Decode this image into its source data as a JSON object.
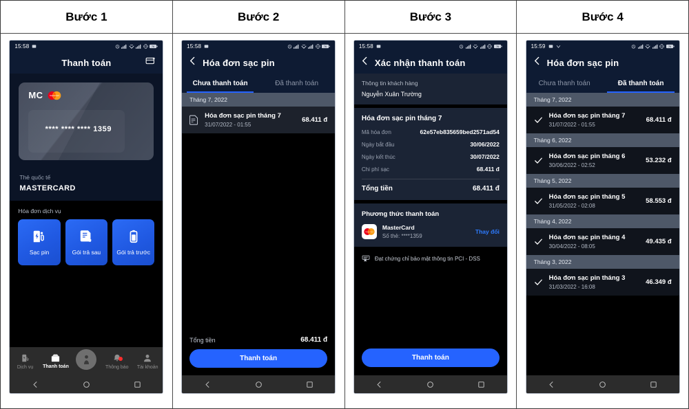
{
  "table": {
    "headers": [
      "Bước 1",
      "Bước 2",
      "Bước 3",
      "Bước 4"
    ]
  },
  "status_bar": {
    "time_1": "15:58",
    "time_2": "15:58",
    "time_3": "15:58",
    "time_4": "15:59",
    "icons": [
      "alarm-icon",
      "signal-icon",
      "wifi-icon",
      "signal-icon",
      "vibrate-icon",
      "battery-icon"
    ]
  },
  "step1": {
    "appbar_title": "Thanh toán",
    "appbar_action_icon": "add-card-icon",
    "card": {
      "brand_text": "MC",
      "brand_logo": "mastercard-logo",
      "number": "**** **** **** 1359"
    },
    "card_type_label": "Thẻ quốc tế",
    "card_type_value": "MASTERCARD",
    "services_title": "Hóa đơn dịch vụ",
    "services": [
      {
        "label": "Sạc pin",
        "icon": "charging-station-icon"
      },
      {
        "label": "Gói trả sau",
        "icon": "invoice-icon"
      },
      {
        "label": "Gói trả trước",
        "icon": "battery-icon"
      }
    ],
    "bottom_nav": [
      {
        "label": "Dịch vụ",
        "icon": "service-icon",
        "active": false
      },
      {
        "label": "Thanh toán",
        "icon": "wallet-icon",
        "active": true
      },
      {
        "label": "",
        "icon": "scooter-icon",
        "active": false
      },
      {
        "label": "Thông báo",
        "icon": "bell-icon",
        "active": false,
        "badge": true
      },
      {
        "label": "Tài khoản",
        "icon": "person-icon",
        "active": false
      }
    ]
  },
  "step2": {
    "appbar_title": "Hóa đơn sạc pin",
    "back_icon": "chevron-left-icon",
    "tabs": [
      {
        "label": "Chưa thanh toán",
        "active": true
      },
      {
        "label": "Đã thanh toán",
        "active": false
      }
    ],
    "groups": [
      {
        "month": "Tháng 7, 2022",
        "items": [
          {
            "name": "Hóa đơn sạc pin tháng 7",
            "date": "31/07/2022 - 01:55",
            "amount": "68.411 đ",
            "icon": "invoice-icon"
          }
        ]
      }
    ],
    "total_label": "Tổng tiền",
    "total_value": "68.411 đ",
    "pay_button": "Thanh toán"
  },
  "step3": {
    "appbar_title": "Xác nhận thanh toán",
    "back_icon": "chevron-left-icon",
    "customer_label": "Thông tin khách hàng",
    "customer_name": "Nguyễn Xuân Trường",
    "invoice_title": "Hóa đơn sạc pin tháng 7",
    "rows": [
      {
        "key": "Mã hóa đơn",
        "value": "62e57eb835659bed2571ad54"
      },
      {
        "key": "Ngày bắt đầu",
        "value": "30/06/2022"
      },
      {
        "key": "Ngày kết thúc",
        "value": "30/07/2022"
      },
      {
        "key": "Chi phí sạc",
        "value": "68.411 đ"
      }
    ],
    "total_label": "Tổng tiền",
    "total_value": "68.411 đ",
    "payment_title": "Phương thức thanh toán",
    "payment_method": {
      "logo": "mastercard-logo",
      "name": "MasterCard",
      "sub": "Số thẻ: ****1359",
      "change_label": "Thay đổi"
    },
    "pci_text": "Đạt chứng chỉ bảo mật thông tin PCI - DSS",
    "pci_icon": "certificate-icon",
    "pay_button": "Thanh toán"
  },
  "step4": {
    "appbar_title": "Hóa đơn sạc pin",
    "back_icon": "chevron-left-icon",
    "tabs": [
      {
        "label": "Chưa thanh toán",
        "active": false
      },
      {
        "label": "Đã thanh toán",
        "active": true
      }
    ],
    "groups": [
      {
        "month": "Tháng 7, 2022",
        "items": [
          {
            "name": "Hóa đơn sạc pin tháng 7",
            "date": "31/07/2022 - 01:55",
            "amount": "68.411 đ",
            "icon": "check-icon"
          }
        ]
      },
      {
        "month": "Tháng 6, 2022",
        "items": [
          {
            "name": "Hóa đơn sạc pin tháng 6",
            "date": "30/06/2022 - 02:52",
            "amount": "53.232 đ",
            "icon": "check-icon"
          }
        ]
      },
      {
        "month": "Tháng 5, 2022",
        "items": [
          {
            "name": "Hóa đơn sạc pin tháng 5",
            "date": "31/05/2022 - 02:08",
            "amount": "58.553 đ",
            "icon": "check-icon"
          }
        ]
      },
      {
        "month": "Tháng 4, 2022",
        "items": [
          {
            "name": "Hóa đơn sạc pin tháng 4",
            "date": "30/04/2022 - 08:05",
            "amount": "49.435 đ",
            "icon": "check-icon"
          }
        ]
      },
      {
        "month": "Tháng 3, 2022",
        "items": [
          {
            "name": "Hóa đơn sạc pin tháng 3",
            "date": "31/03/2022 - 16:08",
            "amount": "46.349 đ",
            "icon": "check-icon"
          }
        ]
      }
    ]
  },
  "colors": {
    "accent_blue": "#2563ff",
    "navy_header": "#0e1b33",
    "card_bg": "#1b2435",
    "month_header": "#4e5868",
    "row_bg": "#1d222c",
    "link_blue": "#2d7bff",
    "badge_red": "#ff2d2d"
  }
}
